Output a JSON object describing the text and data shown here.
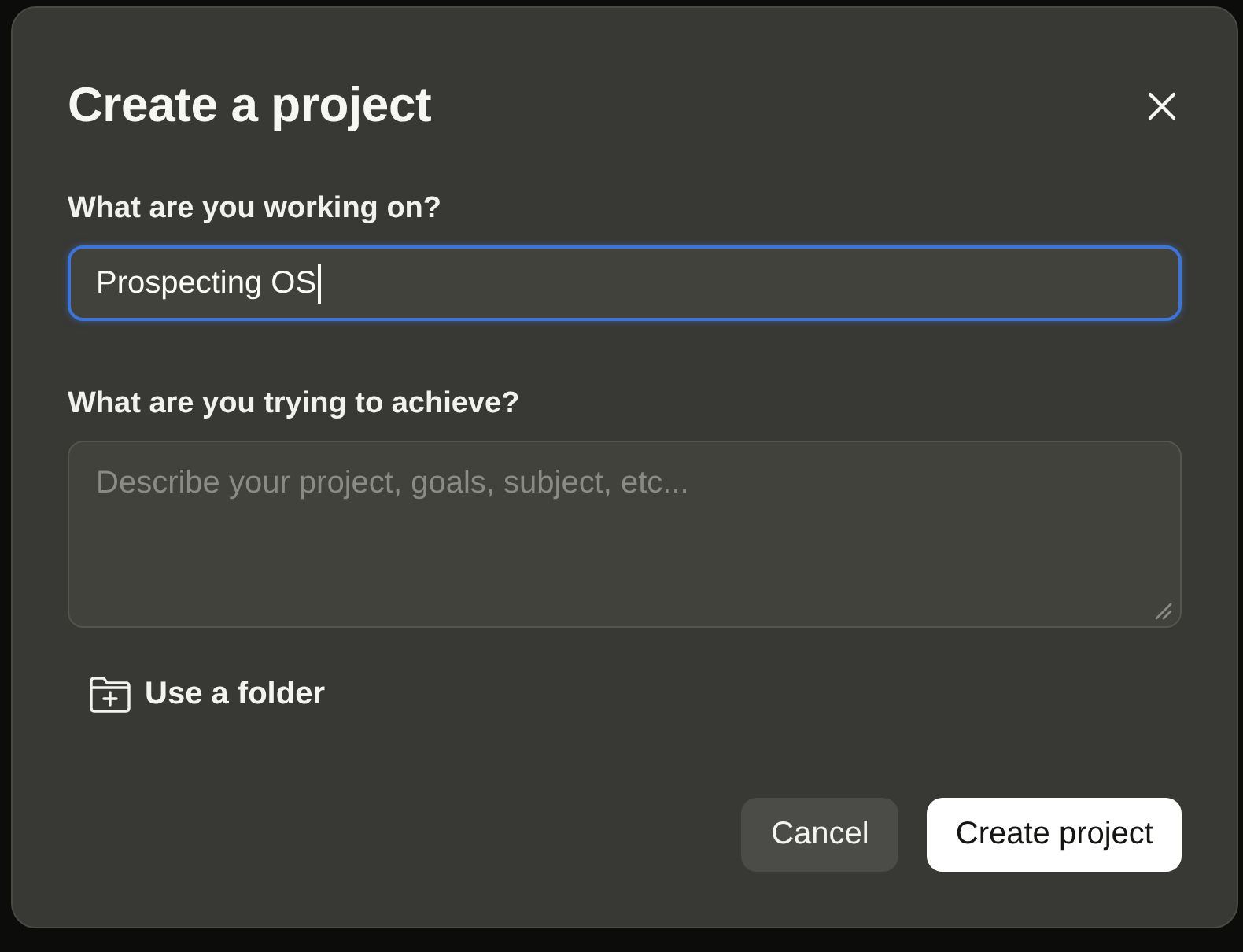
{
  "dialog": {
    "title": "Create a project"
  },
  "fields": [
    {
      "kind": "input",
      "label": "What are you working on?",
      "value": "Prospecting OS",
      "focused": true
    },
    {
      "kind": "textarea",
      "label": "What are you trying to achieve?",
      "placeholder": "Describe your project, goals, subject, etc...",
      "focused": false
    }
  ],
  "folder_link": {
    "label": "Use a folder"
  },
  "buttons": [
    {
      "kind": "secondary",
      "label": "Cancel"
    },
    {
      "kind": "primary",
      "label": "Create project"
    }
  ]
}
